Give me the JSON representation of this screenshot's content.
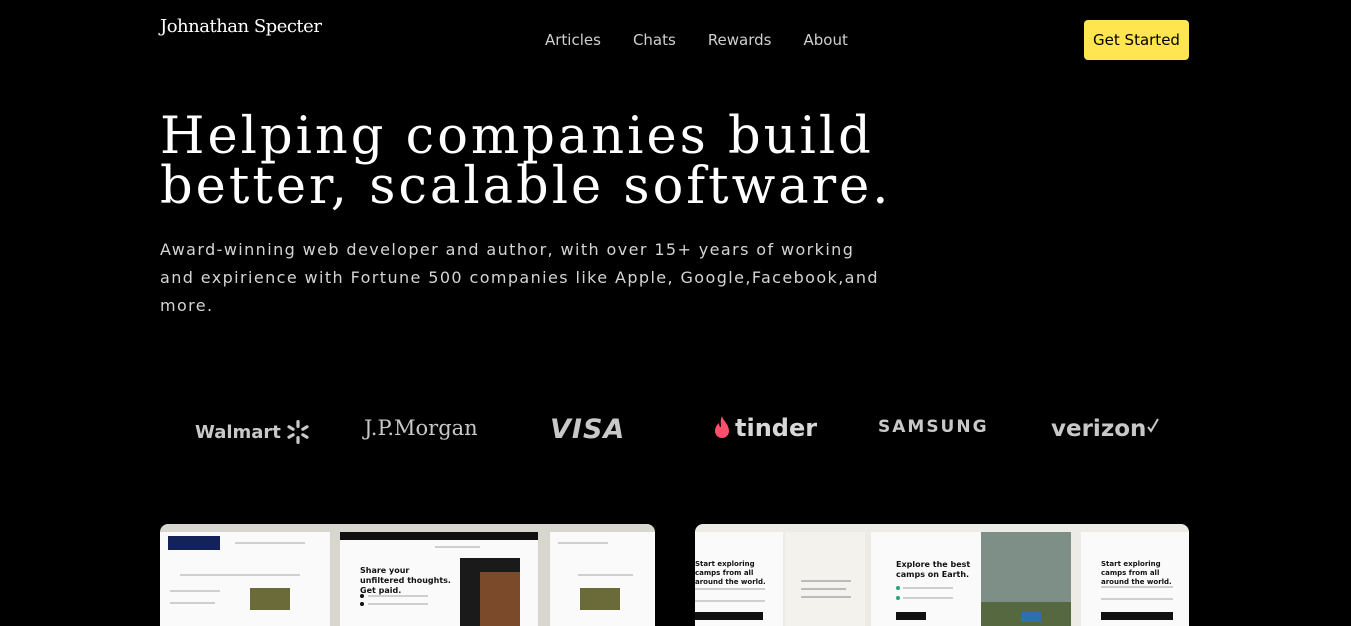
{
  "header": {
    "brand": "Johnathan Specter",
    "nav": [
      "Articles",
      "Chats",
      "Rewards",
      "About"
    ],
    "cta_label": "Get Started",
    "cta_color": "#ffe54f"
  },
  "hero": {
    "title_line1": "Helping companies build",
    "title_line2": "better, scalable software.",
    "subtitle": "Award-winning web developer and author, with over 15+ years of working and expirience with Fortune 500 companies like Apple, Google,Facebook,and more."
  },
  "logos": {
    "walmart": "Walmart",
    "jpmorgan": "J.P.Morgan",
    "visa": "VISA",
    "tinder": "tinder",
    "samsung": "SAMSUNG",
    "verizon": "verizon"
  },
  "projects": {
    "left": {
      "headline": "Share your unfiltered thoughts. Get paid."
    },
    "right": {
      "headline": "Explore the best camps on Earth.",
      "side_heading": "Start exploring camps from all around the world."
    }
  }
}
